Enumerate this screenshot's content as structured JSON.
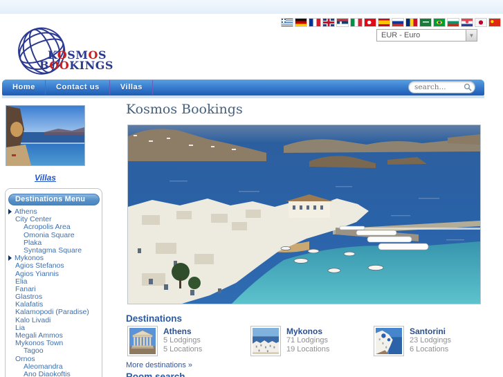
{
  "top_bar": {
    "languages": [
      "greece",
      "germany",
      "france",
      "uk",
      "serbia",
      "italy",
      "turkey",
      "spain",
      "russia",
      "romania",
      "saudi-arabia",
      "brazil",
      "bulgaria",
      "croatia",
      "japan",
      "china"
    ],
    "currency_selected": "EUR - Euro"
  },
  "logo": {
    "line1": "KOSMOS",
    "line2": "BOOKINGS"
  },
  "nav": {
    "items": [
      {
        "label": "Home"
      },
      {
        "label": "Contact us"
      },
      {
        "label": "Villas"
      }
    ],
    "search_placeholder": "search..."
  },
  "sidebar": {
    "villas_link": "Villas",
    "menu_title": "Destinations Menu",
    "menu_items": [
      {
        "label": "Athens",
        "level": 0,
        "arrow": true
      },
      {
        "label": "City Center",
        "level": 1
      },
      {
        "label": "Acropolis Area",
        "level": 2
      },
      {
        "label": "Omonia Square",
        "level": 2
      },
      {
        "label": "Plaka",
        "level": 2
      },
      {
        "label": "Syntagma Square",
        "level": 2
      },
      {
        "label": "Mykonos",
        "level": 0,
        "arrow": true
      },
      {
        "label": "Agios Stefanos",
        "level": 1
      },
      {
        "label": "Agios Yiannis",
        "level": 1
      },
      {
        "label": "Elia",
        "level": 1
      },
      {
        "label": "Fanari",
        "level": 1
      },
      {
        "label": "Glastros",
        "level": 1
      },
      {
        "label": "Kalafatis",
        "level": 1
      },
      {
        "label": "Kalamopodi (Paradise)",
        "level": 1
      },
      {
        "label": "Kalo Livadi",
        "level": 1
      },
      {
        "label": "Lia",
        "level": 1
      },
      {
        "label": "Megali Ammos",
        "level": 1
      },
      {
        "label": "Mykonos Town",
        "level": 1
      },
      {
        "label": "Tagoo",
        "level": 2
      },
      {
        "label": "Ornos",
        "level": 1
      },
      {
        "label": "Aleomandra",
        "level": 2
      },
      {
        "label": "Ano Diaokoftis",
        "level": 2
      }
    ]
  },
  "main": {
    "page_title": "Kosmos Bookings",
    "destinations": {
      "title": "Destinations",
      "cards": [
        {
          "name": "Athens",
          "lodgings": "5 Lodgings",
          "locations": "5 Locations",
          "thumb": "athens"
        },
        {
          "name": "Mykonos",
          "lodgings": "71 Lodgings",
          "locations": "19 Locations",
          "thumb": "mykonos"
        },
        {
          "name": "Santorini",
          "lodgings": "23 Lodgings",
          "locations": "6 Locations",
          "thumb": "santorini"
        }
      ],
      "more_link": "More destinations »"
    },
    "room_search_title": "Room search"
  },
  "colors": {
    "nav_blue": "#2f74c8",
    "link_blue": "#3e6fae",
    "logo_navy": "#2b3990",
    "logo_red": "#cc1f1f"
  }
}
